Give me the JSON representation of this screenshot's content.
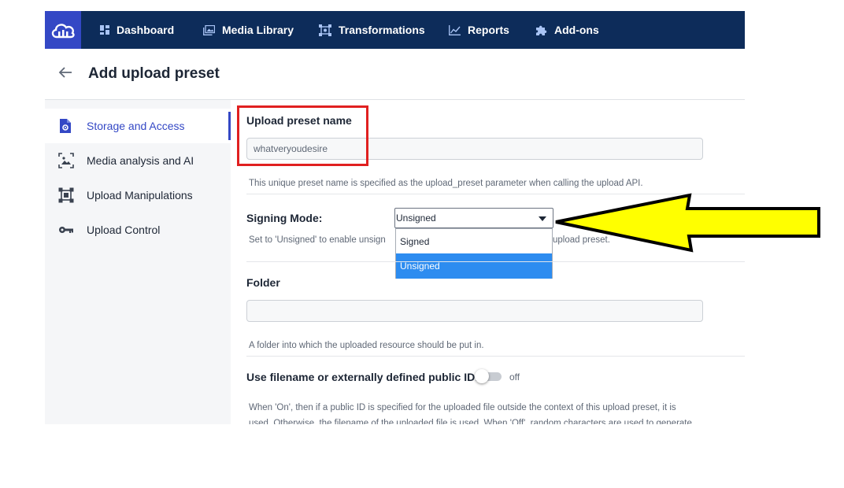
{
  "nav": {
    "items": [
      {
        "label": "Dashboard",
        "icon": "dashboard-icon"
      },
      {
        "label": "Media Library",
        "icon": "media-library-icon"
      },
      {
        "label": "Transformations",
        "icon": "transformations-icon"
      },
      {
        "label": "Reports",
        "icon": "reports-icon"
      },
      {
        "label": "Add-ons",
        "icon": "puzzle-icon"
      }
    ],
    "logo": "cloud-logo-icon"
  },
  "header": {
    "title": "Add upload preset"
  },
  "sidebar": {
    "items": [
      {
        "label": "Storage and Access",
        "icon": "file-gear-icon",
        "active": true
      },
      {
        "label": "Media analysis and AI",
        "icon": "image-analysis-icon"
      },
      {
        "label": "Upload Manipulations",
        "icon": "crop-icon"
      },
      {
        "label": "Upload Control",
        "icon": "key-icon"
      }
    ]
  },
  "form": {
    "preset_name": {
      "label": "Upload preset name",
      "value": "whatveryoudesire",
      "help": "This unique preset name is specified as the upload_preset parameter when calling the upload API."
    },
    "signing_mode": {
      "label": "Signing Mode:",
      "selected": "Unsigned",
      "options": [
        "Signed",
        "Unsigned"
      ],
      "help_left": "Set to 'Unsigned' to enable unsign",
      "help_right": "upload preset."
    },
    "folder": {
      "label": "Folder",
      "value": "",
      "help": "A folder into which the uploaded resource should be put in."
    },
    "use_filename": {
      "label": "Use filename or externally defined public ID:",
      "state": "off",
      "help_line1": "When 'On', then if a public ID is specified for the uploaded file outside the context of this upload preset, it is",
      "help_line2": "used. Otherwise, the filename of the uploaded file is used. When 'Off', random characters are used to generate"
    }
  },
  "colors": {
    "nav_bg": "#0d2c5a",
    "accent": "#3448c5",
    "highlight_box": "#e02020",
    "arrow_fill": "#ffff00",
    "dropdown_selected": "#2d8cf0"
  }
}
